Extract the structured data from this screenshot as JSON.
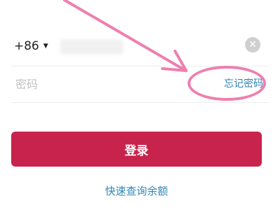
{
  "phone": {
    "country_code": "+86",
    "caret_icon": "caret-down-icon",
    "clear_icon": "clear-icon",
    "clear_glyph": "✕"
  },
  "password": {
    "placeholder": "密码",
    "forgot_label": "忘记密码"
  },
  "actions": {
    "login_label": "登录",
    "balance_label": "快速查询余额"
  },
  "colors": {
    "primary": "#c8234c",
    "link": "#2f7fb3",
    "annotation": "#ee7fae"
  }
}
